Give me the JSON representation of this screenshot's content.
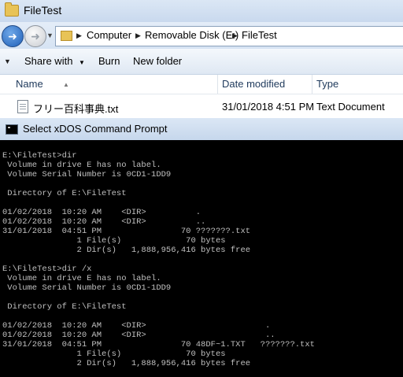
{
  "explorer": {
    "title": "FileTest",
    "breadcrumbs": [
      "Computer",
      "Removable Disk (E:)",
      "FileTest"
    ],
    "toolbar": [
      "Share with",
      "Burn",
      "New folder"
    ],
    "columns": [
      "Name",
      "Date modified",
      "Type"
    ],
    "files": [
      {
        "name": "フリー百科事典.txt",
        "date": "31/01/2018 4:51 PM",
        "type": "Text Document"
      }
    ]
  },
  "dos": {
    "title": "Select xDOS Command Prompt",
    "lines": [
      "E:\\FileTest>dir",
      " Volume in drive E has no label.",
      " Volume Serial Number is 0CD1-1DD9",
      "",
      " Directory of E:\\FileTest",
      "",
      "01/02/2018  10:20 AM    <DIR>          .",
      "01/02/2018  10:20 AM    <DIR>          ..",
      "31/01/2018  04:51 PM                70 ???????.txt",
      "               1 File(s)             70 bytes",
      "               2 Dir(s)   1,888,956,416 bytes free",
      "",
      "E:\\FileTest>dir /x",
      " Volume in drive E has no label.",
      " Volume Serial Number is 0CD1-1DD9",
      "",
      " Directory of E:\\FileTest",
      "",
      "01/02/2018  10:20 AM    <DIR>                        .",
      "01/02/2018  10:20 AM    <DIR>                        ..",
      "31/01/2018  04:51 PM                70 48DF~1.TXT   ???????.txt",
      "               1 File(s)             70 bytes",
      "               2 Dir(s)   1,888,956,416 bytes free"
    ]
  },
  "colors": {
    "console_bg": "#000000",
    "console_text": "#c0c0c0"
  }
}
